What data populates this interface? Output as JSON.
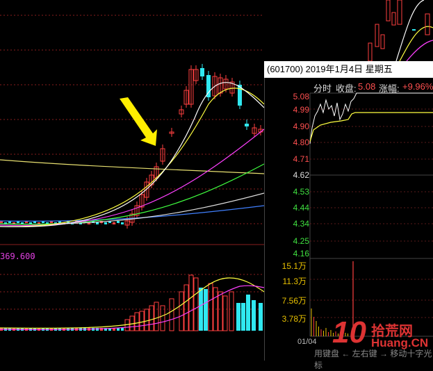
{
  "popup": {
    "stock_code": "(601700)",
    "date": "2019年1月4日",
    "weekday": "星期五",
    "tab_label": "分时",
    "close_label": "收盘:",
    "close_value": "5.08",
    "change_label": "涨幅:",
    "change_value": "+9.96%"
  },
  "price_axis": [
    "5.08",
    "4.99",
    "4.90",
    "4.80",
    "4.71",
    "4.62",
    "4.53",
    "4.44",
    "4.34",
    "4.25",
    "4.16"
  ],
  "volume_axis": [
    "15.1万",
    "11.3万",
    "7.56万",
    "3.78万"
  ],
  "time_axis_label": "01/04",
  "volume_ma_label": "369.600",
  "down_arrow": "↓",
  "watermark": {
    "number": "10",
    "name": "拾荒网",
    "url": "Huang.CN"
  },
  "footer_text": "用键盘 ← 左右键 → 移动十字光标",
  "colors": {
    "up": "#ff4040",
    "down": "#30e8f0",
    "ma5": "#ffffff",
    "ma10": "#ffff40",
    "ma20": "#ff40ff",
    "ma30": "#40ff40",
    "ma60": "#e0e0e0",
    "ma120": "#4080ff"
  }
}
